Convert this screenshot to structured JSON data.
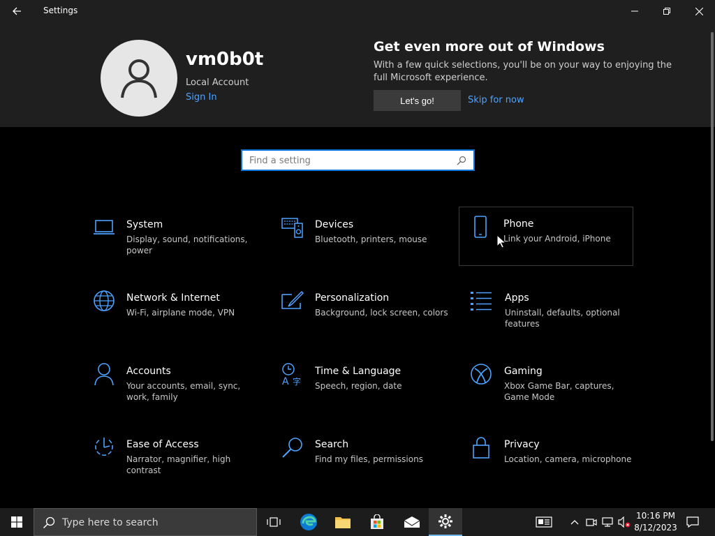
{
  "window": {
    "title": "Settings"
  },
  "profile": {
    "username": "vm0b0t",
    "account_type": "Local Account",
    "sign_in": "Sign In"
  },
  "promo": {
    "title": "Get even more out of Windows",
    "text": "With a few quick selections, you'll be on your way to enjoying the full Microsoft experience.",
    "primary_button": "Let's go!",
    "skip_link": "Skip for now"
  },
  "search": {
    "placeholder": "Find a setting"
  },
  "categories": [
    {
      "title": "System",
      "desc": "Display, sound, notifications, power",
      "icon": "laptop-icon"
    },
    {
      "title": "Devices",
      "desc": "Bluetooth, printers, mouse",
      "icon": "devices-icon"
    },
    {
      "title": "Phone",
      "desc": "Link your Android, iPhone",
      "icon": "phone-icon"
    },
    {
      "title": "Network & Internet",
      "desc": "Wi-Fi, airplane mode, VPN",
      "icon": "globe-icon"
    },
    {
      "title": "Personalization",
      "desc": "Background, lock screen, colors",
      "icon": "paint-icon"
    },
    {
      "title": "Apps",
      "desc": "Uninstall, defaults, optional features",
      "icon": "apps-list-icon"
    },
    {
      "title": "Accounts",
      "desc": "Your accounts, email, sync, work, family",
      "icon": "person-icon"
    },
    {
      "title": "Time & Language",
      "desc": "Speech, region, date",
      "icon": "time-language-icon"
    },
    {
      "title": "Gaming",
      "desc": "Xbox Game Bar, captures, Game Mode",
      "icon": "xbox-icon"
    },
    {
      "title": "Ease of Access",
      "desc": "Narrator, magnifier, high contrast",
      "icon": "ease-of-access-icon"
    },
    {
      "title": "Search",
      "desc": "Find my files, permissions",
      "icon": "search-icon"
    },
    {
      "title": "Privacy",
      "desc": "Location, camera, microphone",
      "icon": "lock-icon"
    }
  ],
  "taskbar": {
    "search_placeholder": "Type here to search",
    "time": "10:16 PM",
    "date": "8/12/2023"
  },
  "colors": {
    "accent": "#0a74da",
    "icon_blue": "#4ea3ff",
    "link": "#4ea3ff"
  }
}
